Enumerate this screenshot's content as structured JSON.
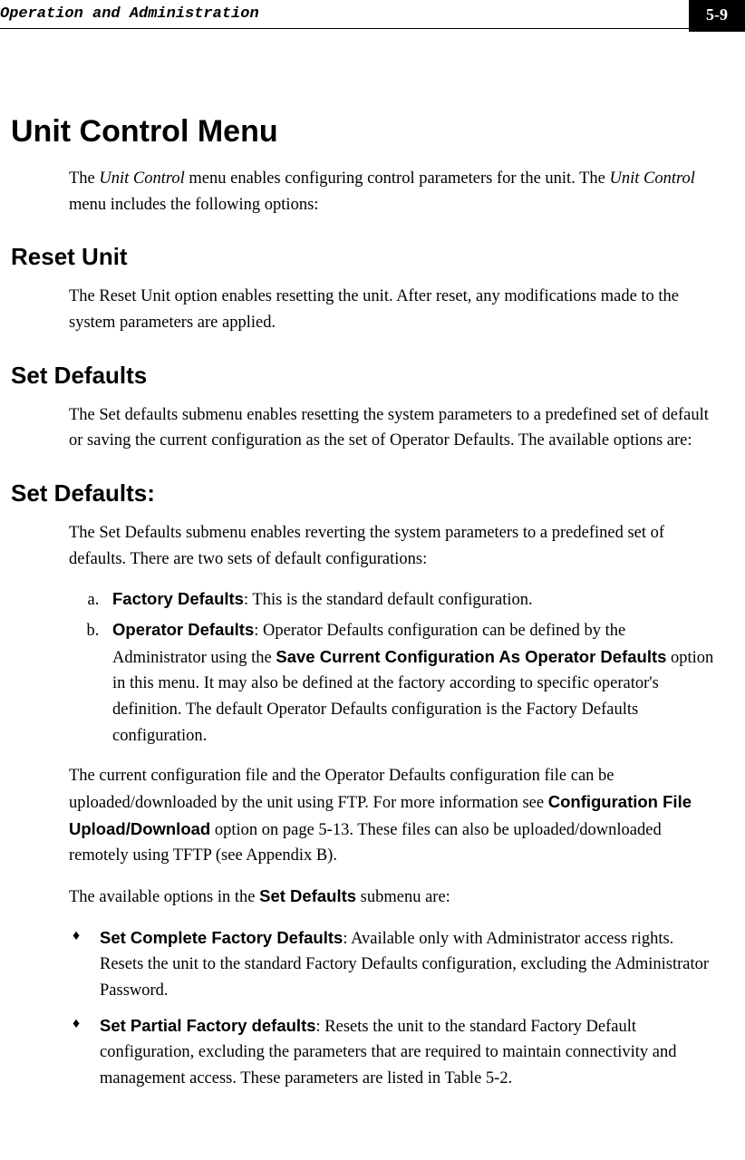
{
  "header": {
    "chapter": "Operation and Administration",
    "page_number": "5-9"
  },
  "h1": "Unit Control Menu",
  "intro_p_pre": "The ",
  "intro_italic1": "Unit Control",
  "intro_p_mid": " menu enables configuring control parameters for the unit. The ",
  "intro_italic2": "Unit Control",
  "intro_p_post": " menu includes the following options:",
  "h2_reset": "Reset Unit",
  "reset_p": "The Reset Unit option enables resetting the unit. After reset, any modifications made to the system parameters are applied.",
  "h2_setdef": "Set Defaults",
  "setdef_p": "The Set defaults submenu enables resetting the system parameters to a predefined set of default or saving the current configuration as the set of Operator Defaults. The available options are:",
  "h2_setdef2": "Set Defaults:",
  "setdef2_p": "The Set Defaults submenu enables reverting the system parameters to a predefined set of defaults. There are two sets of default configurations:",
  "li_a_bold": "Factory Defaults",
  "li_a_rest": ": This is the standard default configuration.",
  "li_b_bold": "Operator Defaults",
  "li_b_mid1": ": Operator Defaults configuration can be defined by the Administrator using the ",
  "li_b_bold2": "Save Current Configuration As Operator Defaults",
  "li_b_mid2": " option in this menu. It may also be defined at the factory according to specific operator's definition. The default Operator Defaults configuration is the Factory Defaults configuration.",
  "p_current_pre": "The current configuration file and the Operator Defaults configuration file can be uploaded/downloaded by the unit using FTP. For more information see ",
  "p_current_bold": "Configuration File Upload/Download",
  "p_current_post": " option on page 5-13. These files can also be uploaded/downloaded remotely using TFTP (see Appendix B).",
  "p_avail_pre": "The available options in the ",
  "p_avail_bold": "Set Defaults",
  "p_avail_post": " submenu are:",
  "bul1_bold": "Set Complete Factory Defaults",
  "bul1_rest": ": Available only with Administrator access rights. Resets the unit to the standard Factory Defaults configuration, excluding the Administrator Password.",
  "bul2_bold": "Set Partial Factory defaults",
  "bul2_rest": ": Resets the unit to the standard Factory Default configuration, excluding the parameters that are required to maintain connectivity and management access. These parameters are listed in Table 5-2."
}
